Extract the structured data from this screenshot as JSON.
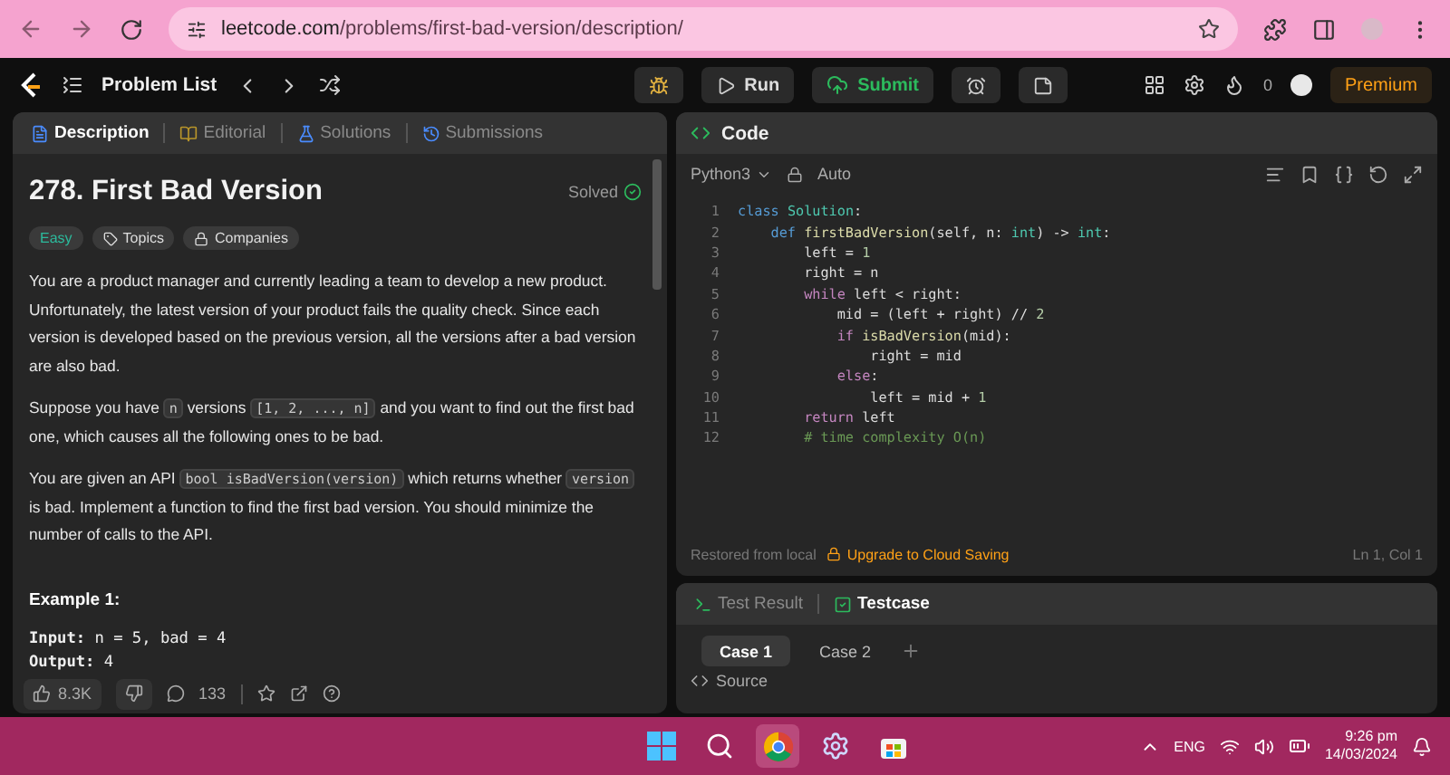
{
  "browser": {
    "url_host": "leetcode.com",
    "url_path": "/problems/first-bad-version/description/"
  },
  "toolbar": {
    "problem_list": "Problem List",
    "run": "Run",
    "submit": "Submit",
    "streak": "0",
    "premium": "Premium"
  },
  "description_tabs": [
    {
      "label": "Description",
      "kind": "description",
      "selected": true
    },
    {
      "label": "Editorial",
      "kind": "editorial",
      "selected": false
    },
    {
      "label": "Solutions",
      "kind": "solutions",
      "selected": false
    },
    {
      "label": "Submissions",
      "kind": "submissions",
      "selected": false
    }
  ],
  "problem": {
    "title": "278. First Bad Version",
    "status": "Solved",
    "tags": [
      {
        "label": "Easy",
        "kind": "difficulty"
      },
      {
        "label": "Topics",
        "kind": "topics"
      },
      {
        "label": "Companies",
        "kind": "companies"
      }
    ],
    "paragraphs": [
      [
        {
          "kind": "text",
          "text": "You are a product manager and currently leading a team to develop a new product. Unfortunately, the latest version of your product fails the quality check. Since each version is developed based on the previous version, all the versions after a bad version are also bad."
        }
      ],
      [
        {
          "kind": "text",
          "text": "Suppose you have "
        },
        {
          "kind": "code",
          "text": "n"
        },
        {
          "kind": "text",
          "text": " versions "
        },
        {
          "kind": "code",
          "text": "[1, 2, ..., n]"
        },
        {
          "kind": "text",
          "text": " and you want to find out the first bad one, which causes all the following ones to be bad."
        }
      ],
      [
        {
          "kind": "text",
          "text": "You are given an API "
        },
        {
          "kind": "code",
          "text": "bool isBadVersion(version)"
        },
        {
          "kind": "text",
          "text": " which returns whether "
        },
        {
          "kind": "code",
          "text": "version"
        },
        {
          "kind": "text",
          "text": " is bad. Implement a function to find the first bad version. You should minimize the number of calls to the API."
        }
      ]
    ],
    "example_heading": "Example 1:",
    "example_lines": [
      "**Input:** n = 5, bad = 4",
      "**Output:** 4"
    ]
  },
  "footer": {
    "likes": "8.3K",
    "comments": "133"
  },
  "editor": {
    "title": "Code",
    "language": "Python3",
    "mode": "Auto",
    "lines": [
      {
        "number": "1",
        "tokens": [
          {
            "text": "class ",
            "kind": "kw"
          },
          {
            "text": "Solution",
            "kind": "type"
          },
          {
            "text": ":",
            "kind": "plain"
          }
        ]
      },
      {
        "number": "2",
        "tokens": [
          {
            "text": "    def ",
            "kind": "kw"
          },
          {
            "text": "firstBadVersion",
            "kind": "fn"
          },
          {
            "text": "(self, n: ",
            "kind": "plain"
          },
          {
            "text": "int",
            "kind": "type"
          },
          {
            "text": ") -> ",
            "kind": "plain"
          },
          {
            "text": "int",
            "kind": "type"
          },
          {
            "text": ":",
            "kind": "plain"
          }
        ]
      },
      {
        "number": "3",
        "tokens": [
          {
            "text": "        left = ",
            "kind": "plain"
          },
          {
            "text": "1",
            "kind": "num"
          }
        ]
      },
      {
        "number": "4",
        "tokens": [
          {
            "text": "        right = n",
            "kind": "plain"
          }
        ]
      },
      {
        "number": "5",
        "tokens": [
          {
            "text": "        while ",
            "kind": "ctrl"
          },
          {
            "text": "left < right:",
            "kind": "plain"
          }
        ]
      },
      {
        "number": "6",
        "tokens": [
          {
            "text": "            mid = (left + right) // ",
            "kind": "plain"
          },
          {
            "text": "2",
            "kind": "num"
          }
        ]
      },
      {
        "number": "7",
        "tokens": [
          {
            "text": "            if ",
            "kind": "ctrl"
          },
          {
            "text": "isBadVersion",
            "kind": "fn"
          },
          {
            "text": "(mid):",
            "kind": "plain"
          }
        ]
      },
      {
        "number": "8",
        "tokens": [
          {
            "text": "                right = mid",
            "kind": "plain"
          }
        ]
      },
      {
        "number": "9",
        "tokens": [
          {
            "text": "            else",
            "kind": "ctrl"
          },
          {
            "text": ":",
            "kind": "plain"
          }
        ]
      },
      {
        "number": "10",
        "tokens": [
          {
            "text": "                left = mid + ",
            "kind": "plain"
          },
          {
            "text": "1",
            "kind": "num"
          }
        ]
      },
      {
        "number": "11",
        "tokens": [
          {
            "text": "        return ",
            "kind": "ctrl"
          },
          {
            "text": "left",
            "kind": "plain"
          }
        ]
      },
      {
        "number": "12",
        "tokens": [
          {
            "text": "        # time complexity O(n)",
            "kind": "comment"
          }
        ]
      }
    ],
    "status": "Restored from local",
    "upgrade": "Upgrade to Cloud Saving",
    "cursor": "Ln 1, Col 1"
  },
  "console": {
    "tabs": [
      {
        "label": "Test Result",
        "kind": "result",
        "selected": false
      },
      {
        "label": "Testcase",
        "kind": "testcase",
        "selected": true
      }
    ],
    "cases": [
      {
        "label": "Case 1",
        "selected": true
      },
      {
        "label": "Case 2",
        "selected": false
      }
    ],
    "source": "Source"
  },
  "taskbar": {
    "apps": [
      {
        "kind": "windows",
        "active": false
      },
      {
        "kind": "search",
        "active": false
      },
      {
        "kind": "chrome",
        "active": true
      },
      {
        "kind": "settings",
        "active": false
      },
      {
        "kind": "store",
        "active": false
      }
    ],
    "lang": "ENG",
    "time": "9:26 pm",
    "date": "14/03/2024"
  }
}
